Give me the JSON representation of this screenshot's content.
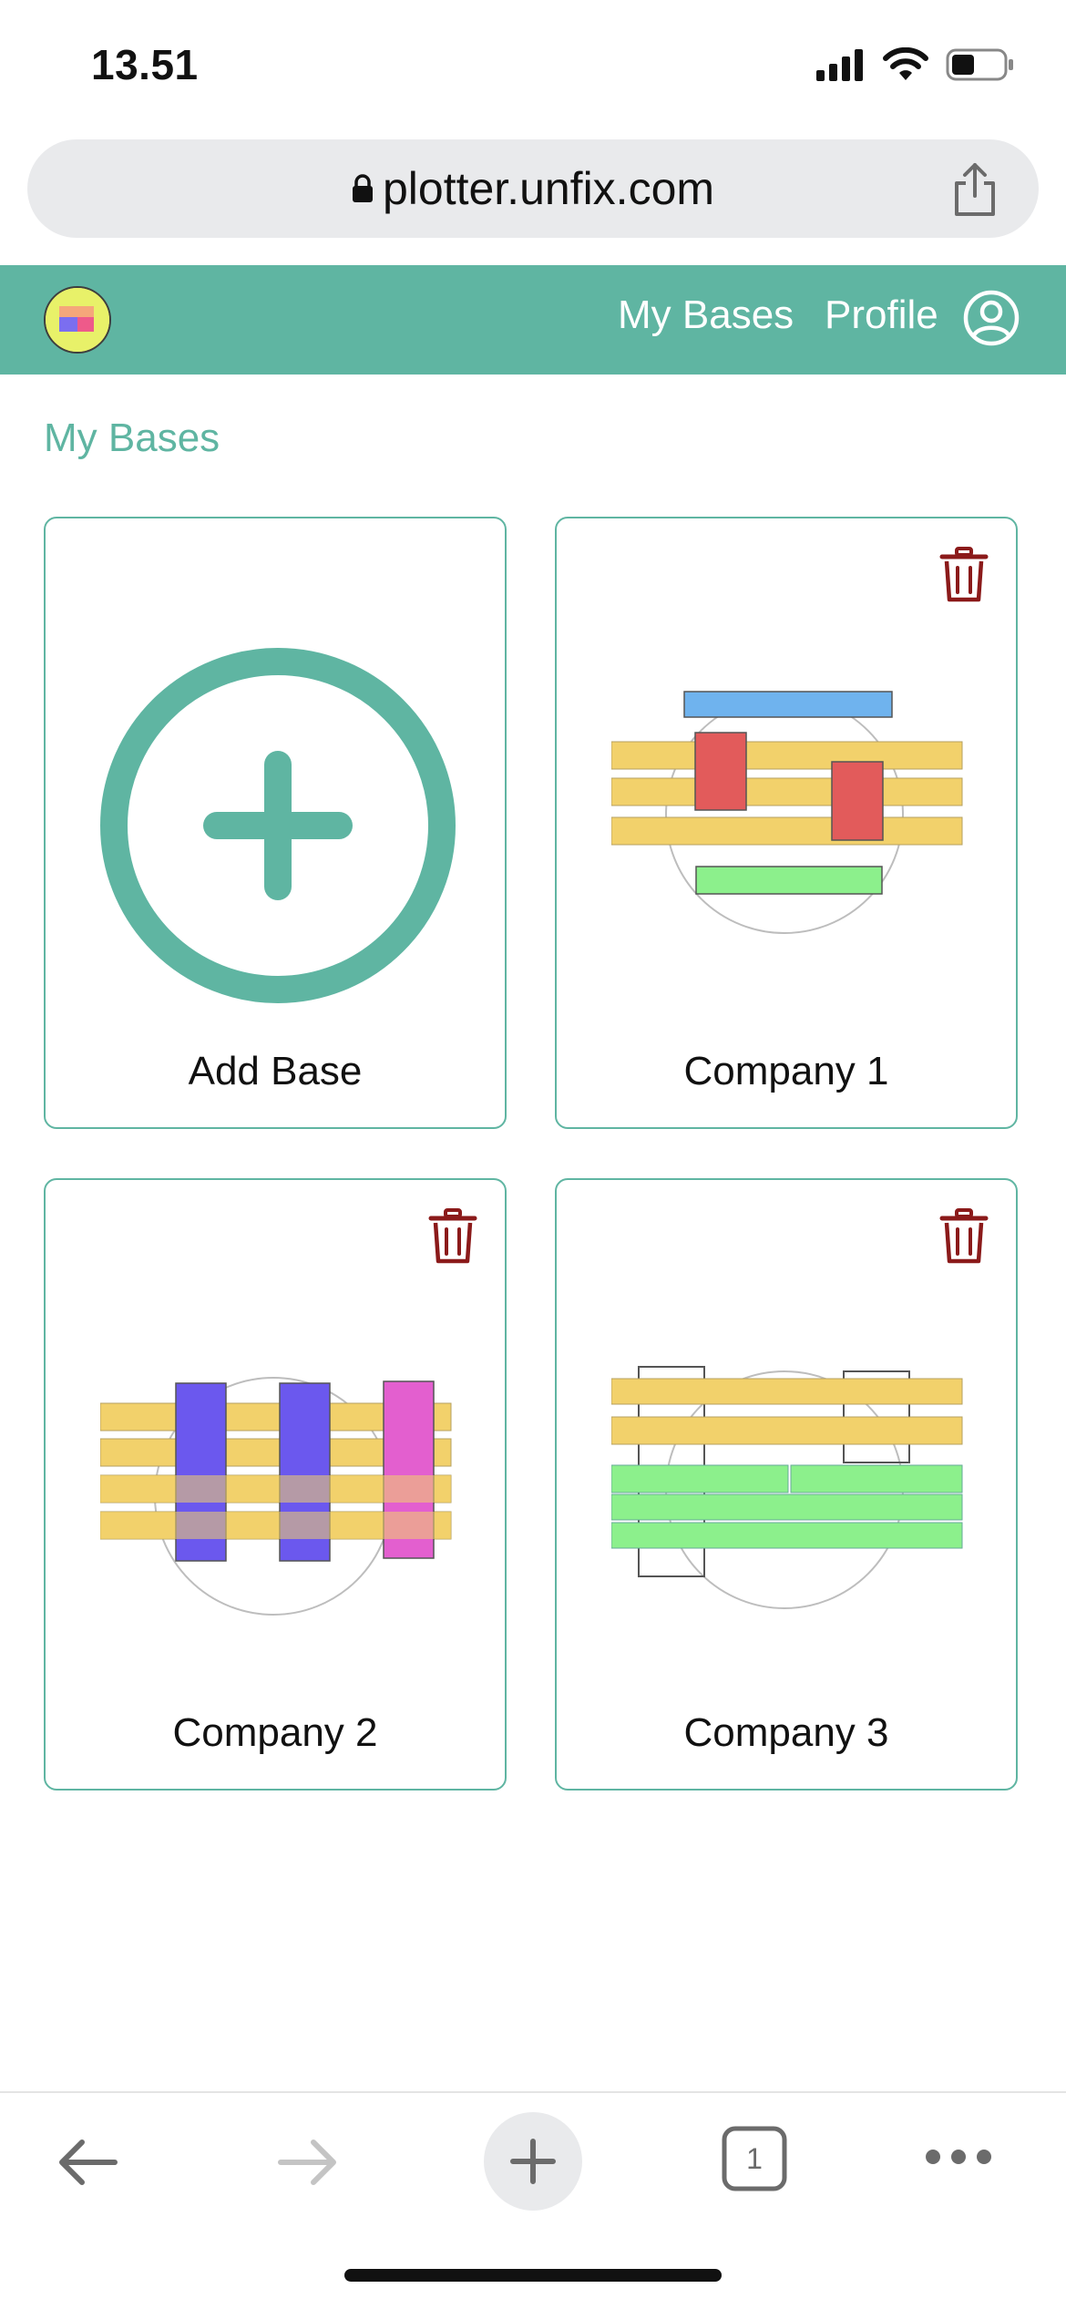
{
  "status_bar": {
    "time": "13.51"
  },
  "browser": {
    "url": "plotter.unfix.com",
    "tab_count": "1"
  },
  "header": {
    "nav_my_bases": "My Bases",
    "nav_profile": "Profile"
  },
  "page": {
    "title": "My Bases",
    "cards": [
      {
        "label": "Add Base"
      },
      {
        "label": "Company 1"
      },
      {
        "label": "Company 2"
      },
      {
        "label": "Company 3"
      }
    ]
  },
  "colors": {
    "accent": "#5fb5a2",
    "trash": "#8b1a1a",
    "beam_yellow": "#f2d16b",
    "blue_top": "#6fb3ee",
    "red_block": "#e25b5b",
    "green_block": "#8cf08c",
    "purple_block": "#6b58ee",
    "pink_block": "#e35fcf"
  }
}
